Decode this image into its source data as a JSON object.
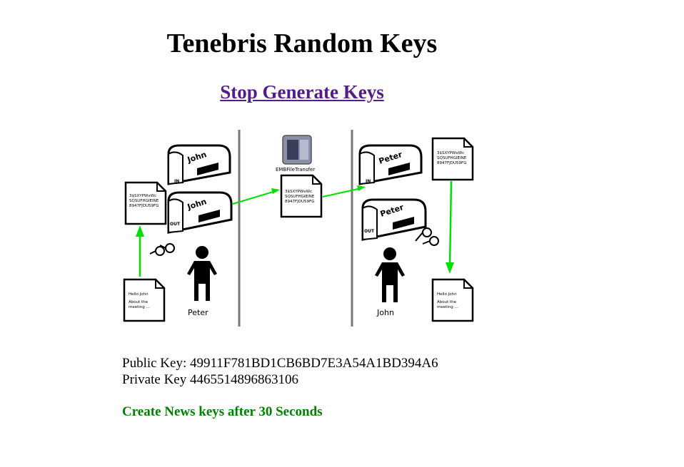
{
  "header": {
    "title": "Tenebris Random Keys",
    "stop_link": "Stop Generate Keys"
  },
  "diagram": {
    "sender": "Peter",
    "receiver": "John",
    "server_label": "EMBFileTransfer",
    "mailbox_sender_in": "John",
    "mailbox_sender_out": "John",
    "mailbox_receiver_in": "Peter",
    "mailbox_receiver_out": "Peter",
    "in_tag": "IN",
    "out_tag": "OUT",
    "encrypted_lines": [
      "3$SXYPWxWc",
      "SQSUFHGIEINE",
      "8947FJDU59FG"
    ],
    "plain_lines": [
      "Hello John",
      "About the",
      "meeting ..."
    ]
  },
  "keys": {
    "public": "Public Key: 49911F781BD1CB6BD7E3A54A1BD394A6",
    "private": "Private Key 4465514896863106"
  },
  "status": {
    "timer": "Create News keys after 30 Seconds"
  }
}
